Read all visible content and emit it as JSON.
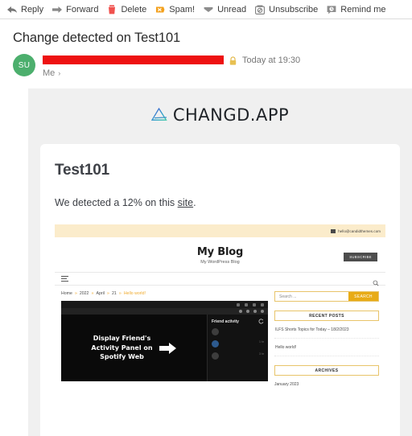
{
  "toolbar": {
    "items": [
      {
        "label": "Reply",
        "icon": "reply-arrow-icon"
      },
      {
        "label": "Forward",
        "icon": "forward-arrow-icon"
      },
      {
        "label": "Delete",
        "icon": "trash-icon"
      },
      {
        "label": "Spam!",
        "icon": "spam-shield-icon"
      },
      {
        "label": "Unread",
        "icon": "envelope-icon"
      },
      {
        "label": "Unsubscribe",
        "icon": "no-entry-icon"
      },
      {
        "label": "Remind me",
        "icon": "clock-bubble-icon"
      }
    ]
  },
  "message": {
    "subject": "Change detected on Test101",
    "avatar_initials": "SU",
    "sender_redacted": true,
    "security_icon": "lock-icon",
    "timestamp": "Today at 19:30",
    "recipient": "Me",
    "recipient_chevron": "›"
  },
  "email": {
    "brand_name": "CHANGD.APP",
    "brand_mark": "triangle-delta-icon",
    "card": {
      "title": "Test101",
      "body_before": "We detected a 12% on this ",
      "link_text": "site",
      "body_after": "."
    },
    "preview": {
      "contact_email": "hello@candidthemes.com",
      "contact_icon": "mail-icon",
      "blog_title": "My Blog",
      "blog_tagline": "My WordPress Blog",
      "subscribe_label": "SUBSCRIBE",
      "menu_icon": "hamburger-icon",
      "search_icon": "search-icon",
      "breadcrumbs": [
        "Home",
        "2022",
        "April",
        "21",
        "Hello world!"
      ],
      "breadcrumb_separator": "»",
      "thumbnail": {
        "caption_lines": [
          "Display Friend's",
          "Activity Panel on",
          "Spotify Web"
        ],
        "arrow_icon": "right-arrow-icon",
        "panel_title": "Friend activity",
        "refresh_icon": "refresh-icon",
        "rows": [
          {
            "time": ""
          },
          {
            "time": "1 hr"
          },
          {
            "time": "3 hr"
          }
        ]
      },
      "sidebar": {
        "search_placeholder": "Search ...",
        "search_button": "SEARCH",
        "recent_posts_title": "RECENT POSTS",
        "recent_posts": [
          "ILFS Shorts Topics for Today – 18/2/2023",
          "Hello world!"
        ],
        "archives_title": "ARCHIVES",
        "archives": [
          "January 2023"
        ]
      }
    }
  },
  "colors": {
    "redaction": "#ee1111",
    "avatar": "#4caf6d",
    "accent_yellow": "#e8ab16",
    "topbar_cream": "#fbeccb",
    "body_gray": "#f0f0f0"
  }
}
